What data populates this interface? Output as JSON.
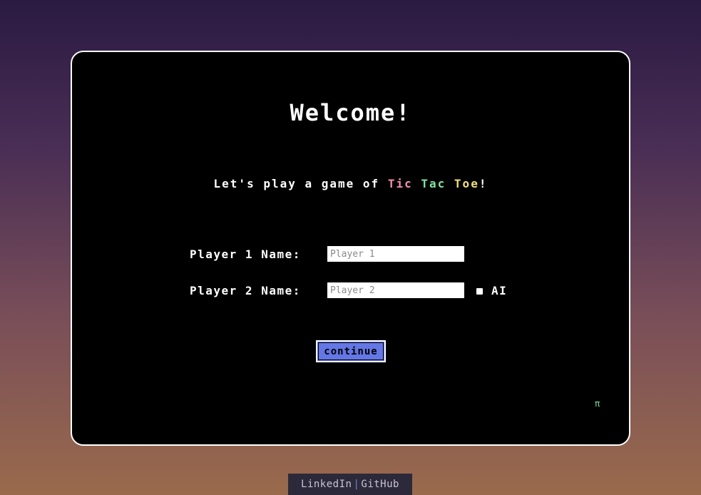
{
  "welcome": {
    "title": "Welcome!",
    "subtitle_prefix": "Let's play a game of ",
    "subtitle_tic": "Tic",
    "subtitle_tac": "Tac",
    "subtitle_toe": "Toe",
    "subtitle_suffix": "!"
  },
  "form": {
    "player1_label": "Player 1 Name:",
    "player1_placeholder": "Player 1",
    "player1_value": "",
    "player2_label": "Player 2 Name:",
    "player2_placeholder": "Player 2",
    "player2_value": "",
    "ai_label": "AI",
    "ai_checked": false,
    "continue_label": "continue"
  },
  "easter_egg": "π",
  "footer": {
    "linkedin_label": "LinkedIn",
    "separator": "|",
    "github_label": "GitHub"
  },
  "colors": {
    "tic": "#f58fb0",
    "tac": "#7fe6a0",
    "toe": "#f4e07a",
    "button": "#6477e6"
  }
}
